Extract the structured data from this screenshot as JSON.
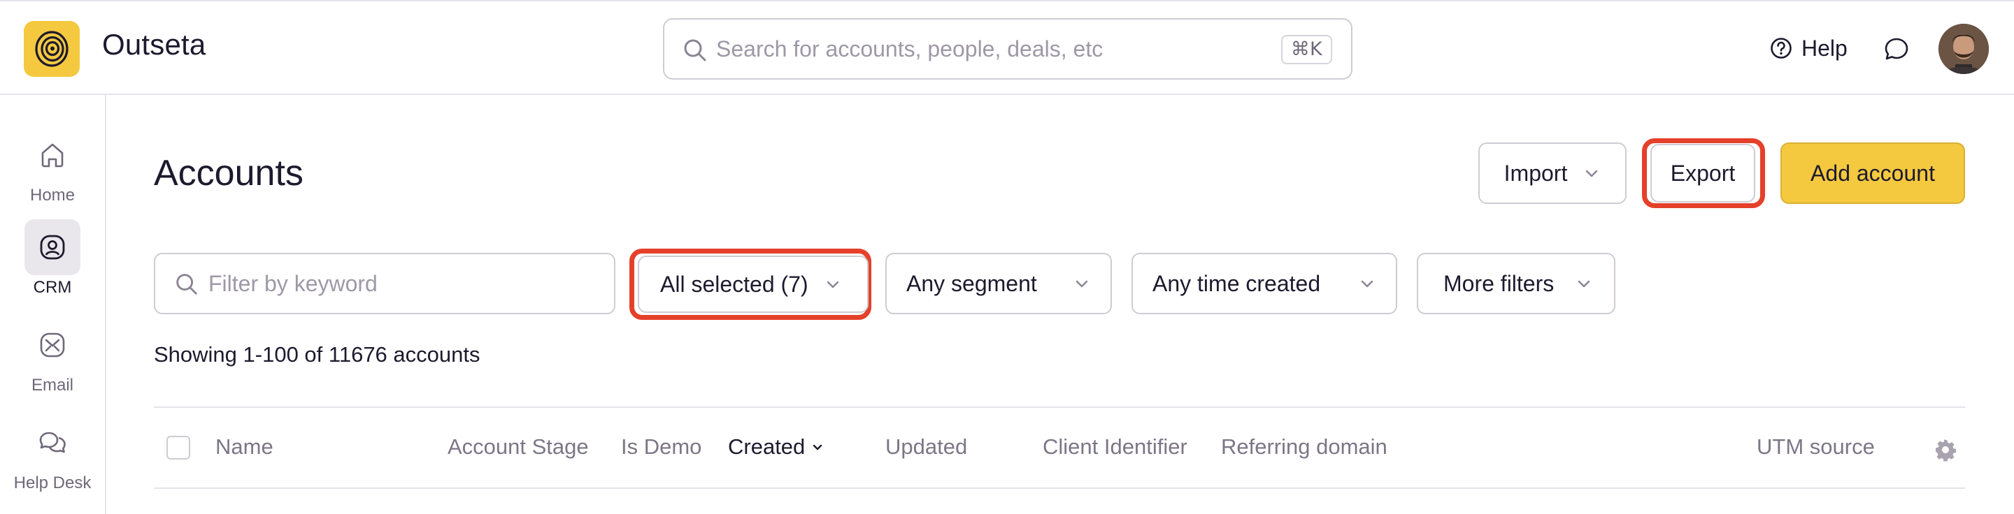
{
  "app": {
    "name": "Outseta",
    "brand_color": "#f4c93f",
    "highlight_color": "#e5402a"
  },
  "topbar": {
    "search_placeholder": "Search for accounts, people, deals, etc",
    "search_shortcut": "⌘K",
    "help_label": "Help",
    "icons": [
      "logo-icon",
      "search-icon",
      "help-icon",
      "chat-icon",
      "user-avatar"
    ]
  },
  "sidebar": {
    "items": [
      {
        "label": "Home",
        "icon": "home-icon",
        "active": false
      },
      {
        "label": "CRM",
        "icon": "crm-icon",
        "active": true
      },
      {
        "label": "Email",
        "icon": "email-icon",
        "active": false
      },
      {
        "label": "Help Desk",
        "icon": "help-desk-icon",
        "active": false
      }
    ]
  },
  "page": {
    "title": "Accounts",
    "actions": {
      "import_label": "Import",
      "export_label": "Export",
      "add_label": "Add account"
    }
  },
  "filters": {
    "keyword_placeholder": "Filter by keyword",
    "status_label": "All selected (7)",
    "segment_label": "Any segment",
    "time_label": "Any time created",
    "more_label": "More filters"
  },
  "results": {
    "summary": "Showing 1-100 of 11676 accounts"
  },
  "table": {
    "columns": [
      {
        "label": "Name"
      },
      {
        "label": "Account Stage"
      },
      {
        "label": "Is Demo"
      },
      {
        "label": "Created",
        "sorted": "desc"
      },
      {
        "label": "Updated"
      },
      {
        "label": "Client Identifier"
      },
      {
        "label": "Referring domain"
      },
      {
        "label": "UTM source"
      }
    ]
  }
}
